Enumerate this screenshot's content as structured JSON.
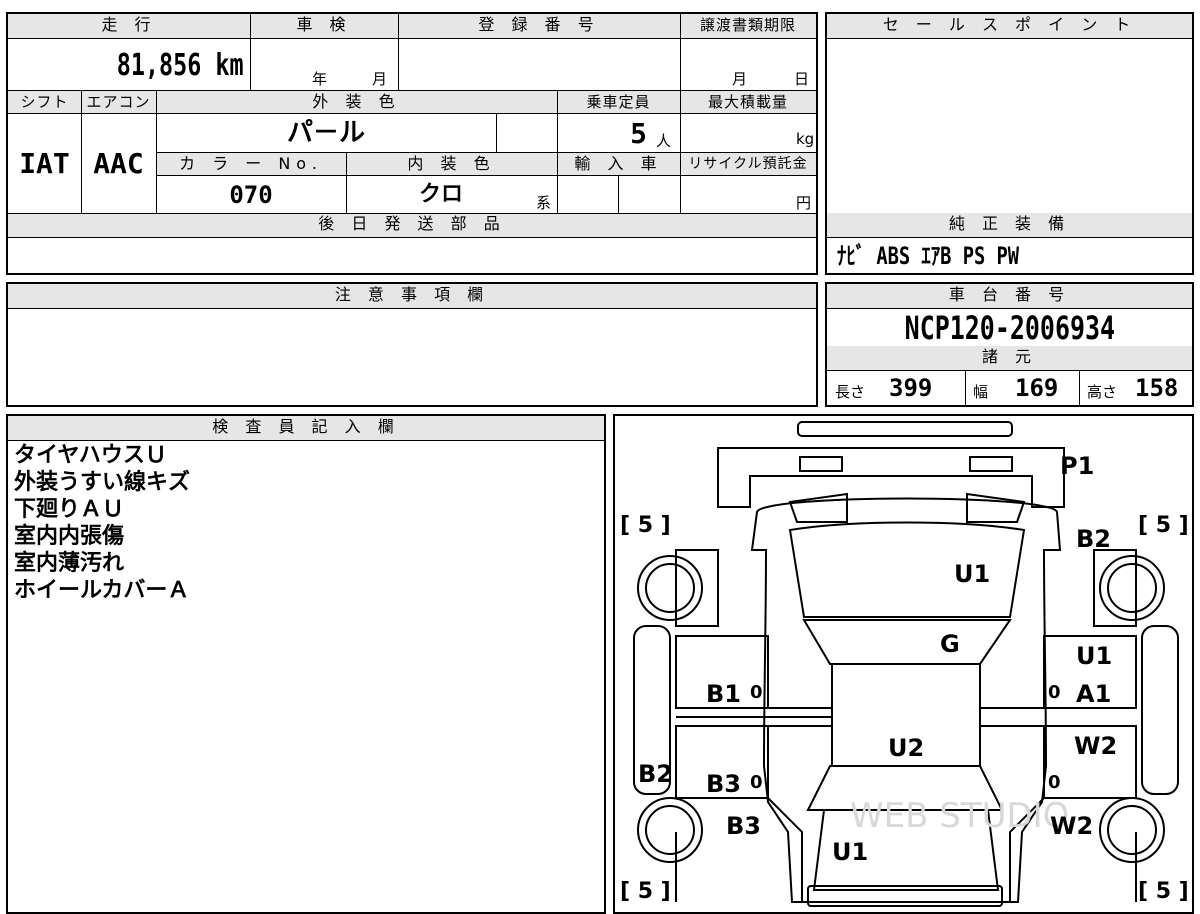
{
  "top_sheet": {
    "headers": {
      "mileage": "走 行",
      "inspection": "車 検",
      "registration": "登 録 番 号",
      "transfer_deadline": "譲渡書類期限",
      "shift": "シフト",
      "aircon": "エアコン",
      "exterior_color": "外 装 色",
      "capacity": "乗車定員",
      "max_load": "最大積載量",
      "color_no": "カ ラ ー No.",
      "interior_color": "内 装 色",
      "import": "輸 入 車",
      "recycle": "リサイクル預託金",
      "later_parts": "後 日 発 送 部 品"
    },
    "values": {
      "mileage": "81,856",
      "mileage_unit": "km",
      "year_label": "年",
      "month_label": "月",
      "transfer_month": "月",
      "transfer_day": "日",
      "shift": "IAT",
      "aircon": "AAC",
      "exterior_color": "パ－ル",
      "capacity": "5",
      "capacity_unit": "人",
      "load_unit": "kg",
      "color_no": "070",
      "interior_color": "クロ",
      "interior_suffix": "系",
      "recycle_unit": "円"
    }
  },
  "sales_point": {
    "header": "セ ー ル ス ポ イ ン ト",
    "equipment_header": "純 正 装 備",
    "equipment": "ﾅﾋﾞ ABS ｴｱB PS PW"
  },
  "caution": {
    "header": "注 意 事 項 欄"
  },
  "chassis": {
    "header": "車 台 番 号",
    "number": "NCP120-2006934",
    "specs_header": "諸 元",
    "length_label": "長さ",
    "length": "399",
    "width_label": "幅",
    "width": "169",
    "height_label": "高さ",
    "height": "158"
  },
  "inspector": {
    "header": "検 査 員 記 入 欄",
    "notes": [
      "タイヤハウスＵ",
      "外装うすい線キズ",
      "下廻りＡＵ",
      "室内内張傷",
      "室内薄汚れ",
      "ホイールカバーＡ"
    ]
  },
  "diagram": {
    "tire_top_left": "[ 5 ]",
    "tire_top_right": "[ 5 ]",
    "tire_bottom_left": "[ 5 ]",
    "tire_bottom_right": "[ 5 ]",
    "marks": {
      "bumper_front": "P1",
      "fender_front_right": "B2",
      "windshield": "U1",
      "hood_rear": "G",
      "door_front_right_top": "U1",
      "door_front_left": "B1",
      "door_front_right": "A1",
      "roof": "U2",
      "door_rear_right": "W2",
      "fender_rear_left": "B2",
      "door_rear_left": "B3",
      "quarter_rear_left": "B3",
      "quarter_rear_right": "W2",
      "rear_glass": "U1"
    },
    "zeros": {
      "fl": "0",
      "fr": "0",
      "rl": "0",
      "rr": "0"
    },
    "watermark": "WEB STUDIO"
  }
}
